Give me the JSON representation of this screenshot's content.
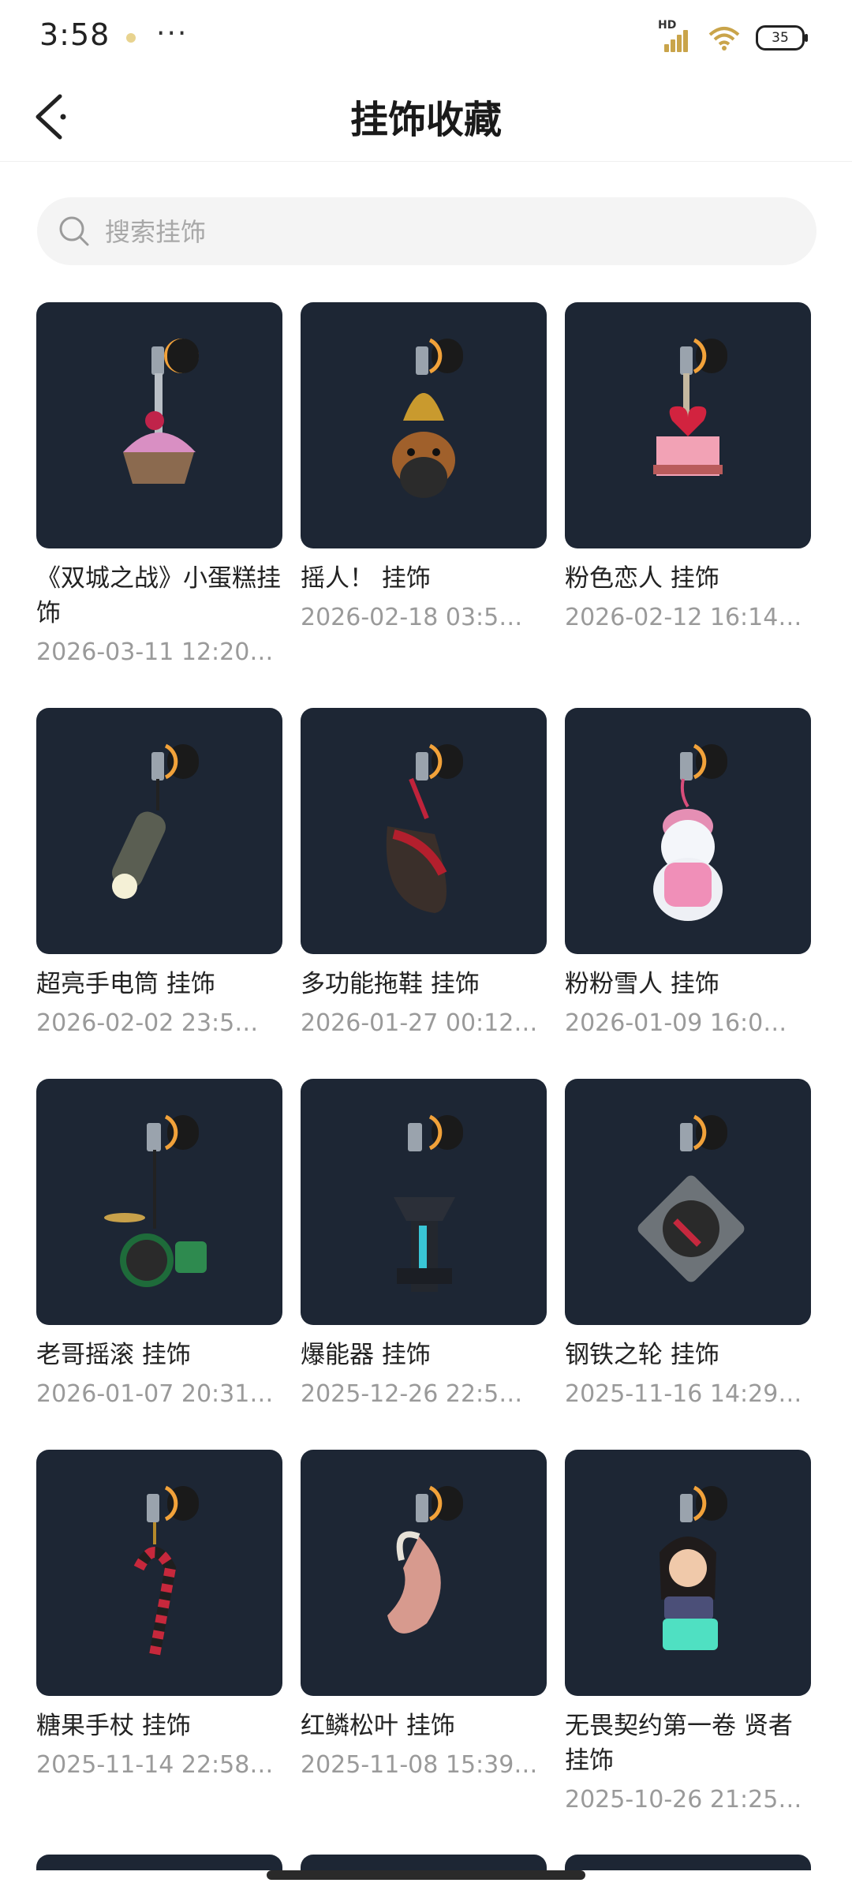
{
  "status_bar": {
    "time": "3:58",
    "more": "···",
    "network": "HD",
    "battery": "35"
  },
  "header": {
    "back_icon": "chevron-left-icon",
    "title": "挂饰收藏"
  },
  "search": {
    "placeholder": "搜索挂饰",
    "icon": "search-icon"
  },
  "items": [
    {
      "title": "《双城之战》小蛋糕挂饰",
      "date": "2026-03-11 12:20:…",
      "art": "cupcake"
    },
    {
      "title": "摇人！ 挂饰",
      "date": "2026-02-18 03:5…",
      "art": "bear-bell"
    },
    {
      "title": "粉色恋人 挂饰",
      "date": "2026-02-12 16:14:…",
      "art": "heart-cake"
    },
    {
      "title": "超亮手电筒 挂饰",
      "date": "2026-02-02 23:5…",
      "art": "flashlight"
    },
    {
      "title": "多功能拖鞋 挂饰",
      "date": "2026-01-27 00:12…",
      "art": "slipper"
    },
    {
      "title": "粉粉雪人 挂饰",
      "date": "2026-01-09 16:0…",
      "art": "snowman"
    },
    {
      "title": "老哥摇滚 挂饰",
      "date": "2026-01-07 20:31…",
      "art": "drums"
    },
    {
      "title": "爆能器 挂饰",
      "date": "2025-12-26 22:5…",
      "art": "blaster"
    },
    {
      "title": "钢铁之轮 挂饰",
      "date": "2025-11-16 14:29:…",
      "art": "turntable"
    },
    {
      "title": "糖果手杖 挂饰",
      "date": "2025-11-14 22:58…",
      "art": "candy-cane"
    },
    {
      "title": "红鳞松叶 挂饰",
      "date": "2025-11-08 15:39…",
      "art": "koi"
    },
    {
      "title": "无畏契约第一卷 贤者挂饰",
      "date": "2025-10-26 21:25…",
      "art": "sage-figure"
    }
  ],
  "colors": {
    "card_bg": "#1d2634",
    "accent_orange": "#f2a23a",
    "text_primary": "#222222",
    "text_secondary": "#9a9a9a"
  }
}
